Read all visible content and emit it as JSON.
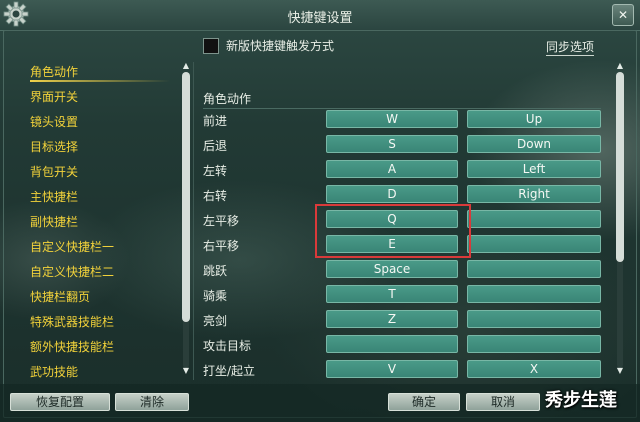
{
  "window": {
    "title": "快捷键设置",
    "close_label": "✕"
  },
  "options": {
    "new_mode_label": "新版快捷键触发方式",
    "sync_label": "同步选项"
  },
  "sidebar": {
    "items": [
      {
        "label": "角色动作",
        "active": true
      },
      {
        "label": "界面开关"
      },
      {
        "label": "镜头设置"
      },
      {
        "label": "目标选择"
      },
      {
        "label": "背包开关"
      },
      {
        "label": "主快捷栏"
      },
      {
        "label": "副快捷栏"
      },
      {
        "label": "自定义快捷栏一"
      },
      {
        "label": "自定义快捷栏二"
      },
      {
        "label": "快捷栏翻页"
      },
      {
        "label": "特殊武器技能栏"
      },
      {
        "label": "额外快捷技能栏"
      },
      {
        "label": "武功技能"
      }
    ]
  },
  "content": {
    "section_title": "角色动作",
    "rows": [
      {
        "name": "前进",
        "key1": "W",
        "key2": "Up"
      },
      {
        "name": "后退",
        "key1": "S",
        "key2": "Down"
      },
      {
        "name": "左转",
        "key1": "A",
        "key2": "Left"
      },
      {
        "name": "右转",
        "key1": "D",
        "key2": "Right"
      },
      {
        "name": "左平移",
        "key1": "Q",
        "key2": ""
      },
      {
        "name": "右平移",
        "key1": "E",
        "key2": ""
      },
      {
        "name": "跳跃",
        "key1": "Space",
        "key2": ""
      },
      {
        "name": "骑乘",
        "key1": "T",
        "key2": ""
      },
      {
        "name": "亮剑",
        "key1": "Z",
        "key2": ""
      },
      {
        "name": "攻击目标",
        "key1": "",
        "key2": ""
      },
      {
        "name": "打坐/起立",
        "key1": "V",
        "key2": "X"
      }
    ]
  },
  "buttons": {
    "restore": "恢复配置",
    "clear": "清除",
    "ok": "确定",
    "cancel": "取消"
  },
  "watermark": "秀步生莲",
  "colors": {
    "highlight_border": "#d93a3a",
    "sidebar_text": "#f2d23a",
    "key_button": "#3f8c7c"
  }
}
